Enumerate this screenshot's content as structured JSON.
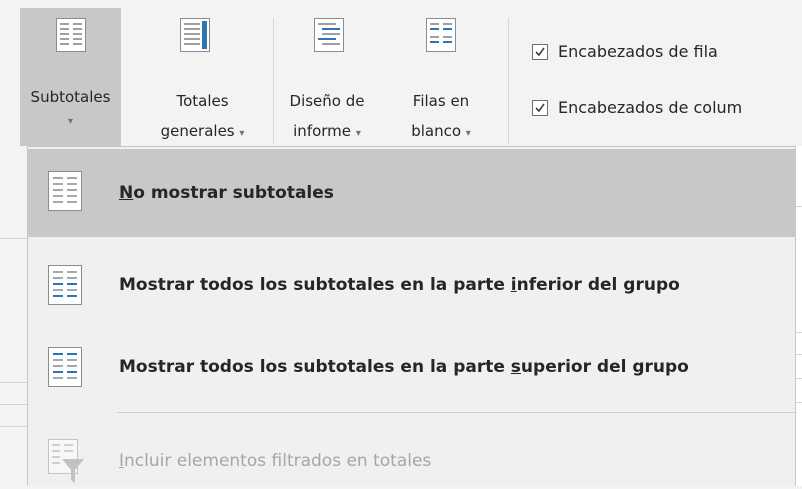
{
  "ribbon": {
    "buttons": [
      {
        "line1": "Subtotales",
        "line2": "",
        "icon": "subtotals-icon"
      },
      {
        "line1": "Totales",
        "line2": "generales",
        "icon": "grand-totals-icon"
      },
      {
        "line1": "Diseño de",
        "line2": "informe",
        "icon": "report-layout-icon"
      },
      {
        "line1": "Filas en",
        "line2": "blanco",
        "icon": "blank-rows-icon"
      }
    ],
    "caret": "▾",
    "checkboxes": [
      {
        "label": "Encabezados de fila",
        "checked": true
      },
      {
        "label": "Encabezados de colum",
        "checked": true
      }
    ]
  },
  "menu": {
    "items": [
      {
        "pre": "",
        "ul": "N",
        "post": "o mostrar subtotales",
        "selected": true,
        "disabled": false
      },
      {
        "pre": "Mostrar todos los subtotales en la parte ",
        "ul": "i",
        "post": "nferior del grupo",
        "selected": false,
        "disabled": false
      },
      {
        "pre": "Mostrar todos los subtotales en la parte ",
        "ul": "s",
        "post": "uperior del grupo",
        "selected": false,
        "disabled": false
      },
      {
        "pre": "",
        "ul": "I",
        "post": "ncluir elementos filtrados en totales",
        "selected": false,
        "disabled": true
      }
    ]
  },
  "colors": {
    "accent_blue": "#2e75b6",
    "selected_bg": "#c8c8c8",
    "disabled_text": "#a6a6a6"
  }
}
